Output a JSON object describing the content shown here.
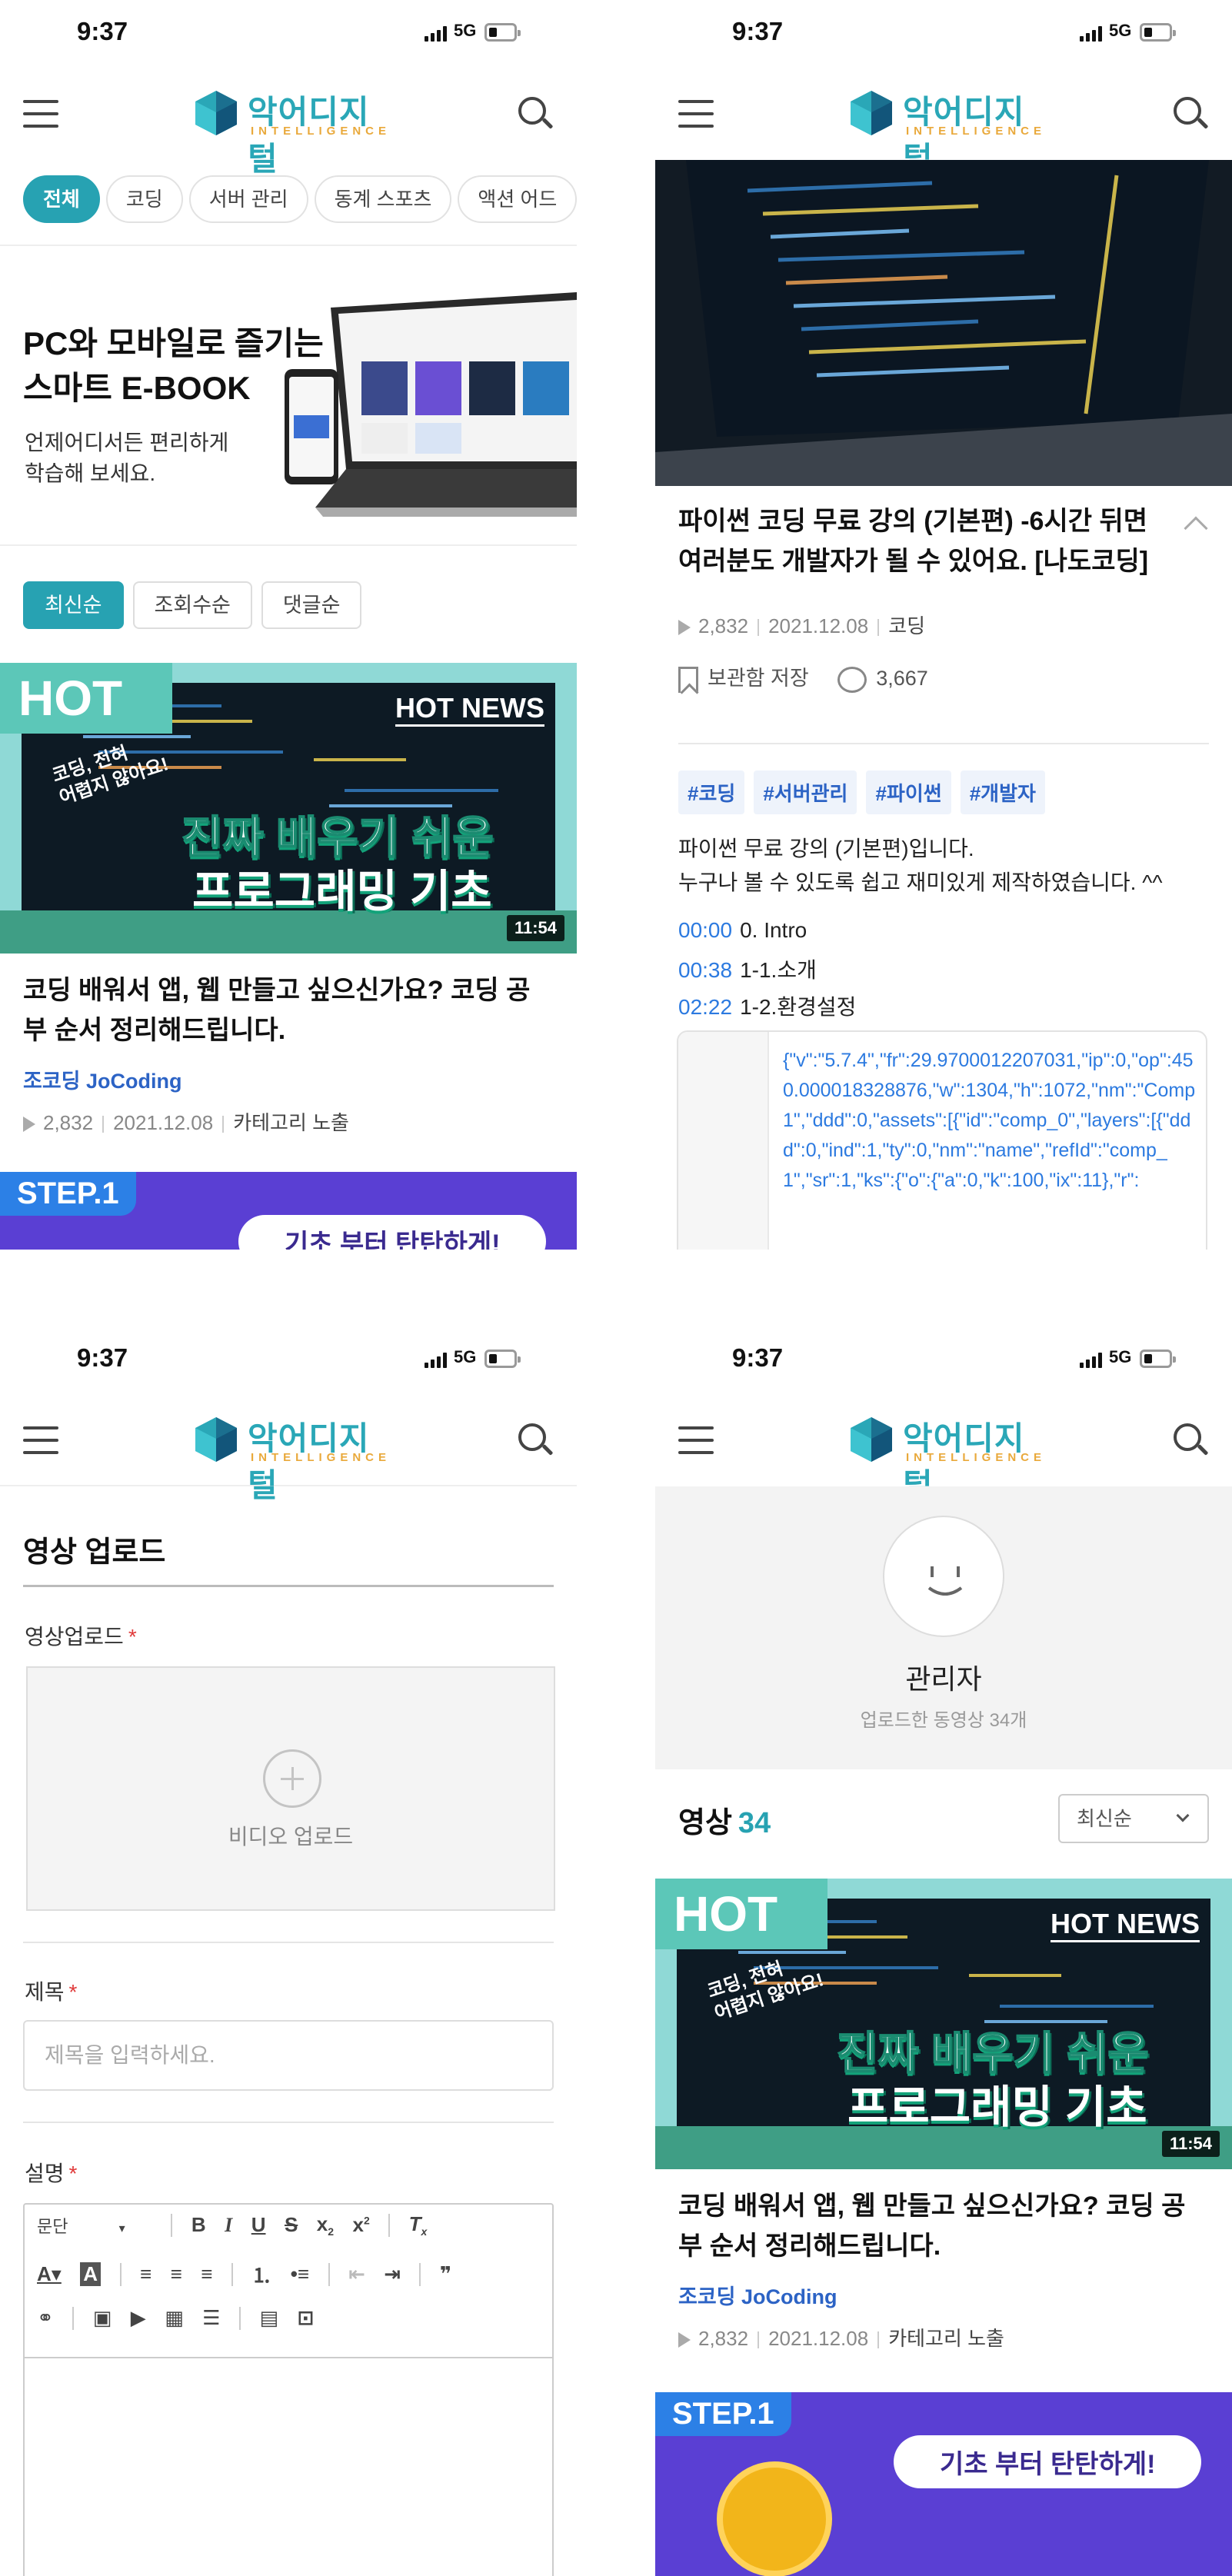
{
  "status": {
    "time": "9:37",
    "network": "5G"
  },
  "logo": {
    "name": "악어디지털",
    "sub": "INTELLIGENCE"
  },
  "home": {
    "categories": [
      "전체",
      "코딩",
      "서버 관리",
      "동계 스포츠",
      "액션 어드"
    ],
    "banner": {
      "line1": "PC와 모바일로 즐기는",
      "line2": "스마트 E-BOOK",
      "sub1": "언제어디서든 편리하게",
      "sub2": "학습해 보세요."
    },
    "sort": [
      "최신순",
      "조회수순",
      "댓글순"
    ]
  },
  "video": {
    "hot": "HOT",
    "hot_news": "HOT NEWS",
    "sticker1": "코딩, 전혀",
    "sticker2": "어렵지 않아요!",
    "headline1": "진짜 배우기 쉬운",
    "headline2": "프로그래밍 기초",
    "duration": "11:54",
    "title": "코딩 배워서 앱, 웹 만들고 싶으신가요? 코딩 공부 순서 정리해드립니다.",
    "author": "조코딩 JoCoding",
    "views": "2,832",
    "date": "2021.12.08",
    "category": "카테고리 노출"
  },
  "step": {
    "label": "STEP.1",
    "sub": "기초 부터 탄탄하게!"
  },
  "detail": {
    "title": "파이썬 코딩 무료 강의 (기본편) -6시간 뒤면 여러분도 개발자가 될 수 있어요. [나도코딩]",
    "views": "2,832",
    "date": "2021.12.08",
    "category": "코딩",
    "save": "보관함 저장",
    "comments": "3,667",
    "tags": [
      "#코딩",
      "#서버관리",
      "#파이썬",
      "#개발자"
    ],
    "desc1": "파이썬 무료 강의 (기본편)입니다.",
    "desc2": "누구나 볼 수 있도록 쉽고 재미있게 제작하였습니다. ^^",
    "chapters": [
      {
        "ts": "00:00",
        "label": "0. Intro"
      },
      {
        "ts": "00:38",
        "label": "1-1.소개"
      },
      {
        "ts": "02:22",
        "label": "1-2.환경설정"
      }
    ],
    "code": "{\"v\":\"5.7.4\",\"fr\":29.9700012207031,\"ip\":0,\"op\":450.000018328876,\"w\":1304,\"h\":1072,\"nm\":\"Comp 1\",\"ddd\":0,\"assets\":[{\"id\":\"comp_0\",\"layers\":[{\"ddd\":0,\"ind\":1,\"ty\":0,\"nm\":\"name\",\"refId\":\"comp_1\",\"sr\":1,\"ks\":{\"o\":{\"a\":0,\"k\":100,\"ix\":11},\"r\":"
  },
  "upload": {
    "title": "영상 업로드",
    "video_label": "영상업로드",
    "video_btn": "비디오 업로드",
    "title_label": "제목",
    "title_placeholder": "제목을 입력하세요.",
    "desc_label": "설명",
    "req": "*",
    "paragraph": "문단"
  },
  "profile": {
    "name": "관리자",
    "sub": "업로드한 동영상 34개",
    "videos_label": "영상",
    "videos_count": "34",
    "sort": "최신순"
  }
}
